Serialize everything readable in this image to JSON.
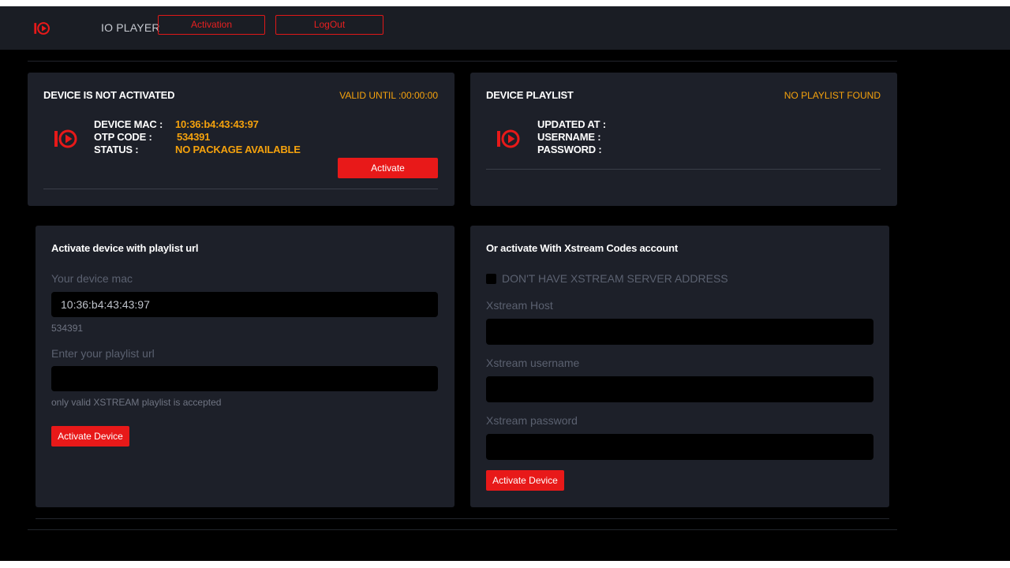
{
  "header": {
    "brand": "IO PLAYER",
    "activation_label": "Activation",
    "logout_label": "LogOut"
  },
  "device_card": {
    "title": "DEVICE IS NOT ACTIVATED",
    "valid_until": "VALID UNTIL :00:00:00",
    "mac_label": "DEVICE MAC :",
    "otp_label": "OTP CODE :",
    "status_label": "STATUS :",
    "mac_value": "10:36:b4:43:43:97",
    "otp_value": "534391",
    "status_value": "NO PACKAGE AVAILABLE",
    "activate_label": "Activate"
  },
  "playlist_card": {
    "title": "DEVICE PLAYLIST",
    "status": "NO PLAYLIST FOUND",
    "updated_label": "UPDATED AT :",
    "username_label": "USERNAME :",
    "password_label": "PASSWORD :"
  },
  "url_form": {
    "title": "Activate device with playlist url",
    "mac_label": "Your device mac",
    "mac_value": "10:36:b4:43:43:97",
    "otp": "534391",
    "url_label": "Enter your playlist url",
    "url_value": "",
    "note": "only valid XSTREAM playlist is accepted",
    "button_label": "Activate Device"
  },
  "xstream_form": {
    "title": "Or activate With Xstream Codes account",
    "checkbox_label": "DON'T HAVE XSTREAM SERVER ADDRESS",
    "host_label": "Xstream Host",
    "username_label": "Xstream username",
    "password_label": "Xstream password",
    "button_label": "Activate Device"
  },
  "colors": {
    "accent": "#e81919",
    "warning": "#f5a20d",
    "card": "#1d2029",
    "background": "#000000"
  }
}
